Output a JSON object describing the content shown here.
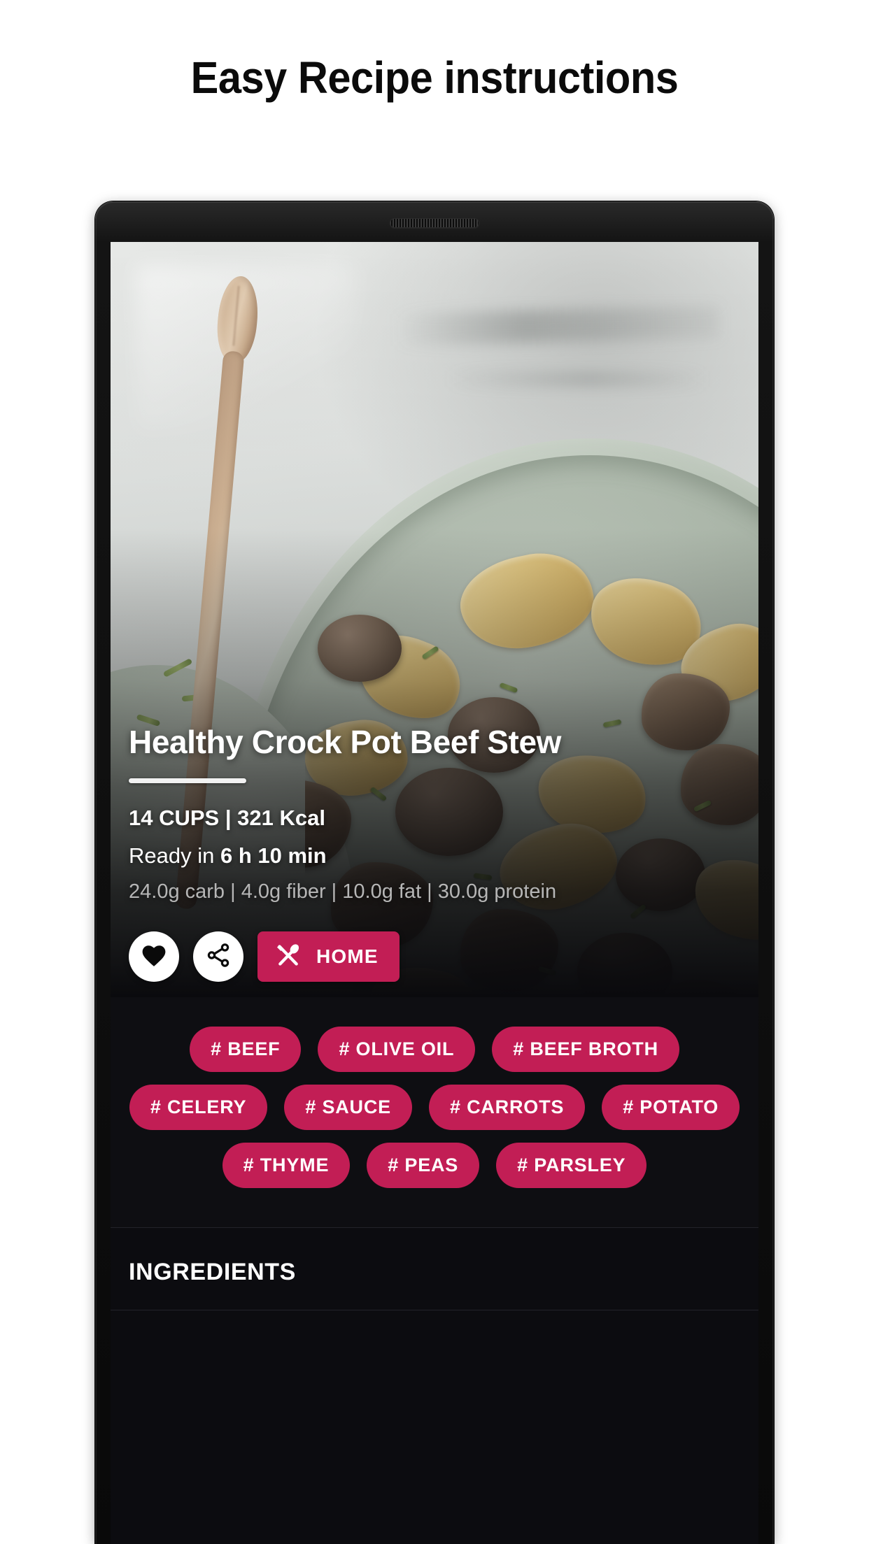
{
  "page": {
    "heading": "Easy Recipe instructions"
  },
  "device": {
    "speaker_icon": "speaker-grille-icon"
  },
  "recipe": {
    "title": "Healthy Crock Pot Beef Stew",
    "servings_calories": "14 CUPS | 321 Kcal",
    "ready_prefix": "Ready in ",
    "ready_time": "6 h 10 min",
    "nutrition": "24.0g carb | 4.0g fiber | 10.0g fat | 30.0g protein"
  },
  "actions": {
    "favorite_icon": "heart-icon",
    "share_icon": "share-icon",
    "home_icon": "fork-spoon-icon",
    "home_label": "HOME"
  },
  "tags": {
    "rows": [
      [
        "# BEEF",
        "# OLIVE OIL",
        "# BEEF BROTH"
      ],
      [
        "# CELERY",
        "# SAUCE",
        "# CARROTS",
        "# POTATO"
      ],
      [
        "# THYME",
        "# PEAS",
        "# PARSLEY"
      ]
    ]
  },
  "ingredients": {
    "title": "INGREDIENTS"
  },
  "colors": {
    "accent": "#c21e55",
    "page_background": "#ffffff",
    "screen_background": "#0c0c10",
    "tag_background": "#0e0e12",
    "text_primary": "#ffffff",
    "text_muted": "#b6b6b6",
    "heading": "#0b0b0b"
  }
}
